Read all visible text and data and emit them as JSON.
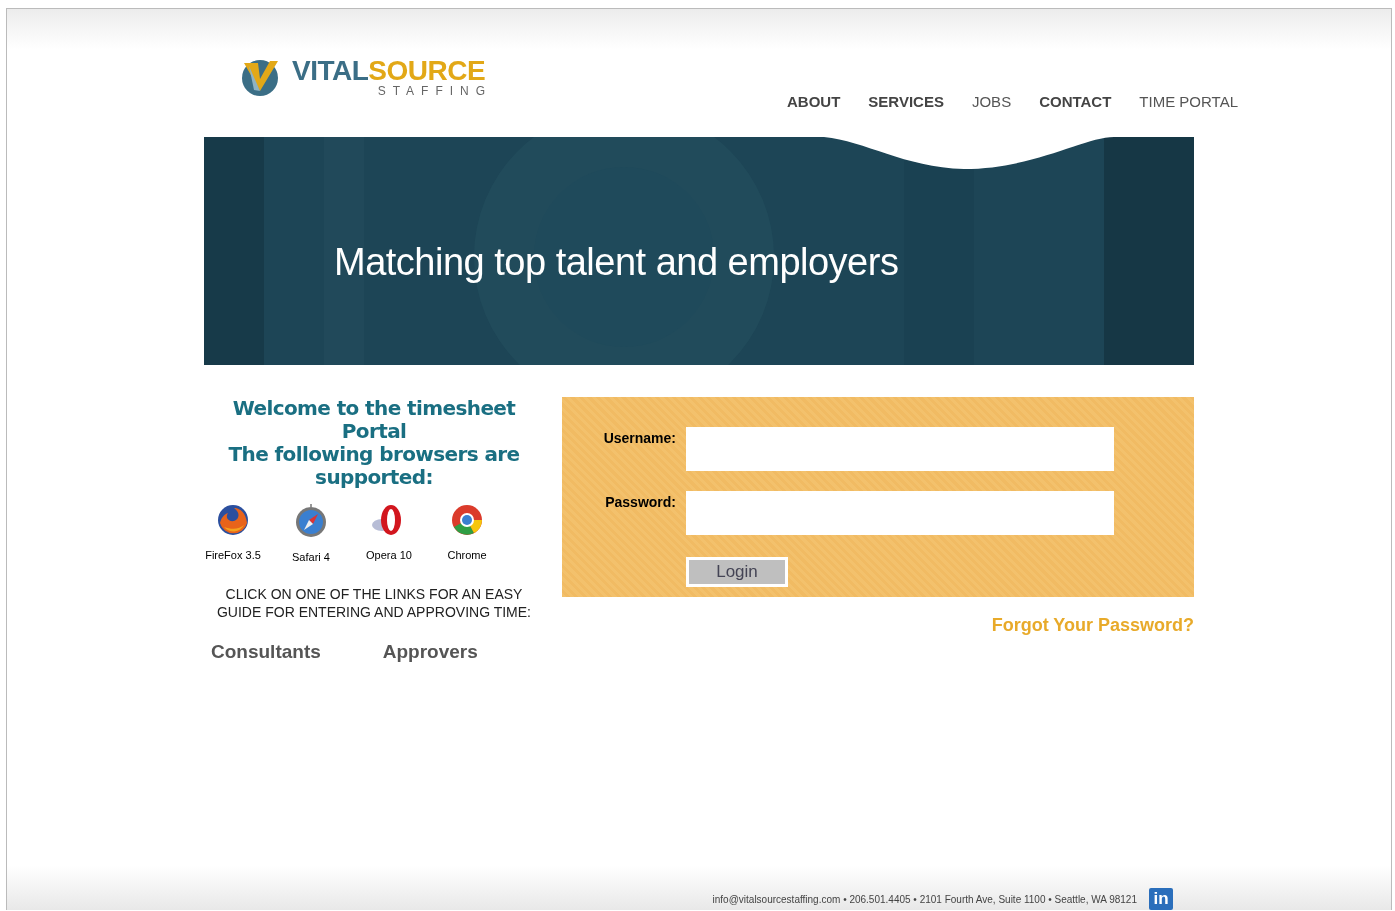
{
  "logo": {
    "word_1": "VITAL",
    "word_2": "SOURCE",
    "tagline": "STAFFING"
  },
  "nav": [
    {
      "label": "ABOUT",
      "kind": "bold"
    },
    {
      "label": "SERVICES",
      "kind": "bold"
    },
    {
      "label": "JOBS",
      "kind": "light"
    },
    {
      "label": "CONTACT",
      "kind": "bold"
    },
    {
      "label": "TIME PORTAL",
      "kind": "light"
    }
  ],
  "banner": {
    "headline": "Matching top talent and employers"
  },
  "welcome": {
    "title": "Welcome to the timesheet Portal",
    "subtitle": "The following browsers are supported:"
  },
  "browsers": [
    {
      "kind": "firefox",
      "label": "FireFox 3.5"
    },
    {
      "kind": "safari",
      "label": "Safari 4"
    },
    {
      "kind": "opera",
      "label": "Opera 10"
    },
    {
      "kind": "chrome",
      "label": "Chrome"
    }
  ],
  "guide_text": "CLICK ON ONE OF THE LINKS FOR AN EASY GUIDE FOR ENTERING AND APPROVING TIME:",
  "guide_links": [
    "Consultants",
    "Approvers"
  ],
  "login": {
    "username_label": "Username:",
    "password_label": "Password:",
    "button": "Login",
    "forgot": "Forgot Your Password?"
  },
  "footer": {
    "contact": "info@vitalsourcestaffing.com • 206.501.4405 • 2101 Fourth Ave, Suite 1100 • Seattle, WA 98121",
    "linkedin": "in"
  }
}
